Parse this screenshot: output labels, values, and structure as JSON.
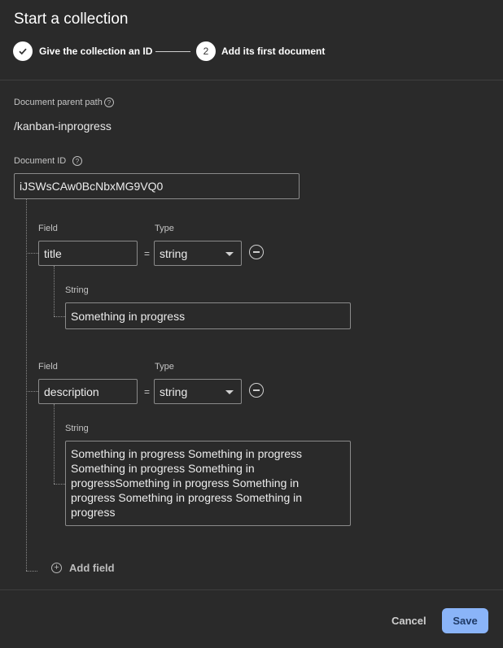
{
  "dialog": {
    "title": "Start a collection"
  },
  "stepper": {
    "step1_label": "Give the collection an ID",
    "step2_number": "2",
    "step2_label": "Add its first document"
  },
  "parent_path": {
    "label": "Document parent path",
    "value": "/kanban-inprogress"
  },
  "document_id": {
    "label": "Document ID",
    "value": "iJSWsCAw0BcNbxMG9VQ0"
  },
  "fields": [
    {
      "field_label": "Field",
      "type_label": "Type",
      "name": "title",
      "equals": "=",
      "type": "string",
      "value_label": "String",
      "value": "Something in progress"
    },
    {
      "field_label": "Field",
      "type_label": "Type",
      "name": "description",
      "equals": "=",
      "type": "string",
      "value_label": "String",
      "value": "Something in progress Something in progress Something in progress Something in progressSomething in progress Something in progress Something in progress Something in progress"
    }
  ],
  "add_field_label": "Add field",
  "footer": {
    "cancel_label": "Cancel",
    "save_label": "Save"
  },
  "colors": {
    "background": "#2a2a2a",
    "accent": "#8ab4f8"
  }
}
